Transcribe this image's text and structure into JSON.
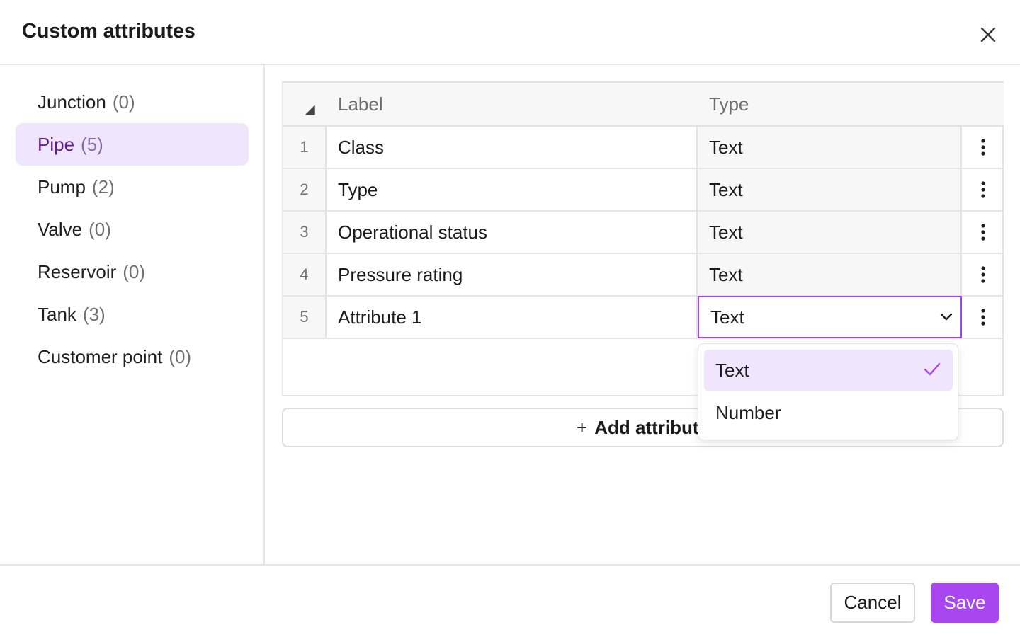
{
  "dialog": {
    "title": "Custom attributes"
  },
  "sidebar": {
    "items": [
      {
        "label": "Junction",
        "count": "(0)"
      },
      {
        "label": "Pipe",
        "count": "(5)",
        "active": true
      },
      {
        "label": "Pump",
        "count": "(2)"
      },
      {
        "label": "Valve",
        "count": "(0)"
      },
      {
        "label": "Reservoir",
        "count": "(0)"
      },
      {
        "label": "Tank",
        "count": "(3)"
      },
      {
        "label": "Customer point",
        "count": "(0)"
      }
    ]
  },
  "table": {
    "headers": {
      "label": "Label",
      "type": "Type"
    },
    "rows": [
      {
        "num": "1",
        "label": "Class",
        "type": "Text"
      },
      {
        "num": "2",
        "label": "Type",
        "type": "Text"
      },
      {
        "num": "3",
        "label": "Operational status",
        "type": "Text"
      },
      {
        "num": "4",
        "label": "Pressure rating",
        "type": "Text"
      },
      {
        "num": "5",
        "label": "Attribute 1",
        "type": "Text",
        "editing": true
      }
    ]
  },
  "add_button": {
    "plus": "+",
    "label": "Add attribute"
  },
  "type_dropdown": {
    "options": [
      {
        "label": "Text",
        "selected": true
      },
      {
        "label": "Number"
      }
    ]
  },
  "footer": {
    "cancel": "Cancel",
    "save": "Save"
  },
  "colors": {
    "accent": "#a847f0",
    "active_bg": "#efe6fd",
    "active_text": "#5e1d8f",
    "border": "#e3e3e3"
  },
  "icons": [
    "close-icon",
    "sort-triangle-icon",
    "kebab-menu-icon",
    "chevron-down-icon",
    "check-icon"
  ]
}
